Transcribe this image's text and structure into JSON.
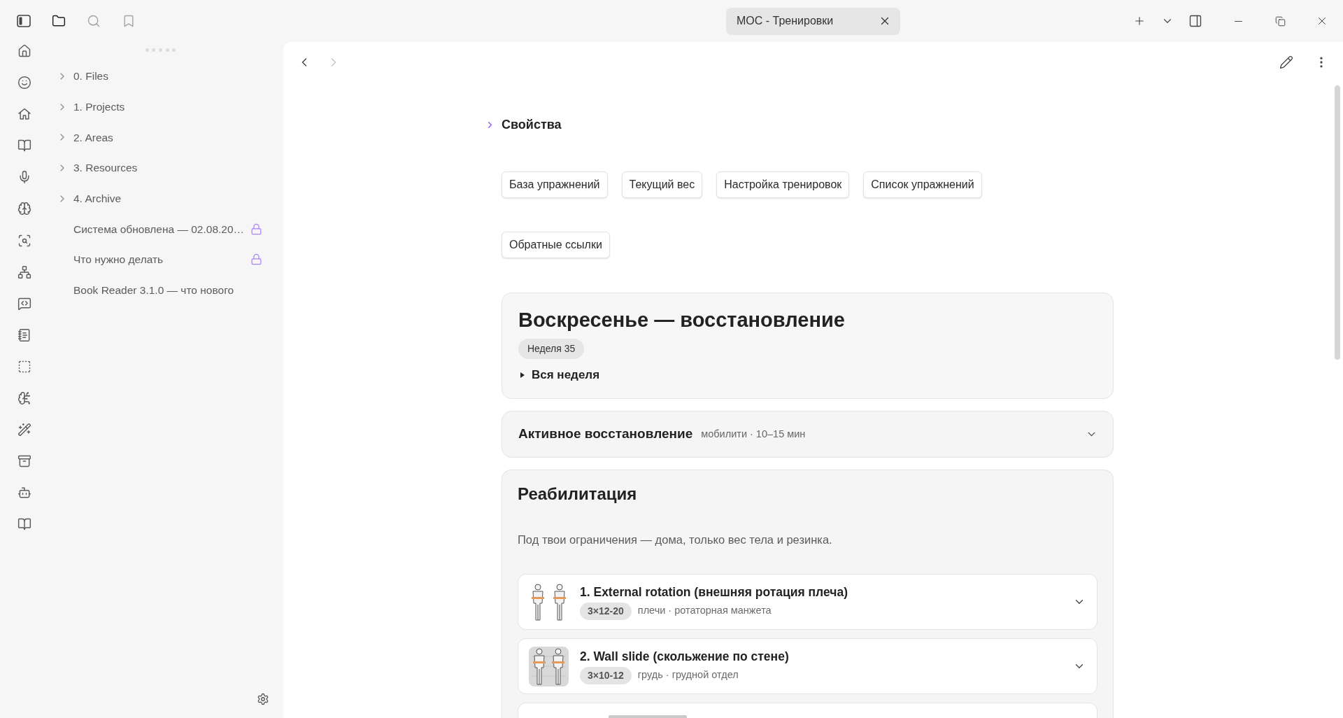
{
  "window": {
    "tab": {
      "title": "MOC - Тренировки",
      "selected": true
    }
  },
  "sidebar": {
    "tabs": [
      {
        "selected": true
      },
      {
        "selected": false
      },
      {
        "selected": false
      }
    ],
    "tree": [
      {
        "label": "0. Files",
        "kind": "folder",
        "expanded": false
      },
      {
        "label": "1. Projects",
        "kind": "folder",
        "expanded": false
      },
      {
        "label": "2. Areas",
        "kind": "folder",
        "expanded": false
      },
      {
        "label": "3. Resources",
        "kind": "folder",
        "expanded": false
      },
      {
        "label": "4. Archive",
        "kind": "folder",
        "expanded": false
      },
      {
        "label": "Система обновлена — 02.08.20…",
        "kind": "file",
        "locked": true
      },
      {
        "label": "Что нужно делать",
        "kind": "file",
        "locked": true
      },
      {
        "label": "Book Reader 3.1.0 — что нового",
        "kind": "file",
        "locked": false
      }
    ]
  },
  "nav": {
    "back_disabled": false,
    "forward_disabled": true
  },
  "note": {
    "properties": {
      "label": "Свойства",
      "expanded": false
    },
    "links": [
      "База упражнений",
      "Текущий вес",
      "Настройка тренировок",
      "Список упражнений",
      "Обратные ссылки"
    ],
    "day_card": {
      "title": "Воскресенье — восстановление",
      "badge": "Неделя 35",
      "details": {
        "label": "Вся неделя",
        "expanded": false
      }
    },
    "sections": [
      {
        "kind": "collapsed",
        "title": "Активное восстановление",
        "subtitle": "мобилити · 10–15 мин"
      },
      {
        "kind": "open",
        "title": "Реабилитация",
        "description": "Под твои ограничения — дома, только вес тела и резинка.",
        "exercises": [
          {
            "kind": "figures",
            "title": "1. External rotation (внешняя ротация плеча)",
            "sets": "3×12-20",
            "tags": "плечи · ротаторная манжета"
          },
          {
            "kind": "tile",
            "title": "2. Wall slide (скольжение по стене)",
            "sets": "3×10-12",
            "tags": "грудь · грудной отдел"
          }
        ],
        "more_below": true
      }
    ]
  }
}
